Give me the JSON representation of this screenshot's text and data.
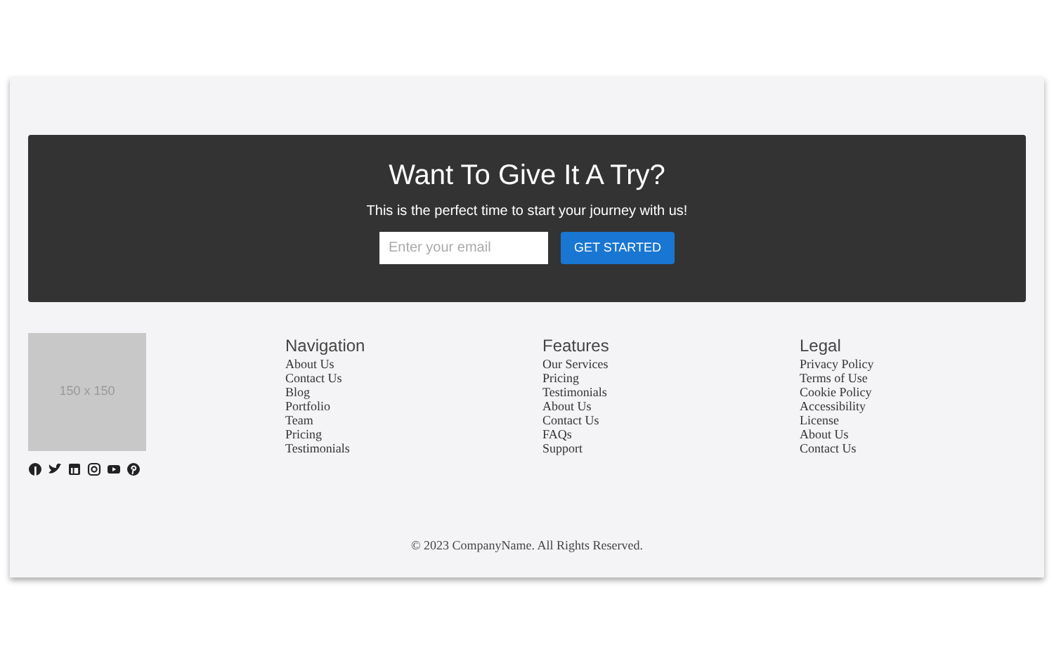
{
  "banner": {
    "title": "Want To Give It A Try?",
    "subtitle": "This is the perfect time to start your journey with us!",
    "email": {
      "placeholder": "Enter your email"
    },
    "button": "GET STARTED"
  },
  "placeholder_image": {
    "label": "150 x 150"
  },
  "social_links": [
    {
      "kind": "facebook"
    },
    {
      "kind": "twitter"
    },
    {
      "kind": "linkedin"
    },
    {
      "kind": "instagram"
    },
    {
      "kind": "youtube"
    },
    {
      "kind": "pinterest"
    }
  ],
  "columns": [
    {
      "title": "Navigation",
      "links": [
        "About Us",
        "Contact Us",
        "Blog",
        "Portfolio",
        "Team",
        "Pricing",
        "Testimonials"
      ]
    },
    {
      "title": "Features",
      "links": [
        "Our Services",
        "Pricing",
        "Testimonials",
        "About Us",
        "Contact Us",
        "FAQs",
        "Support"
      ]
    },
    {
      "title": "Legal",
      "links": [
        "Privacy Policy",
        "Terms of Use",
        "Cookie Policy",
        "Accessibility",
        "License",
        "About Us",
        "Contact Us"
      ]
    }
  ],
  "copyright": "© 2023 CompanyName. All Rights Reserved."
}
